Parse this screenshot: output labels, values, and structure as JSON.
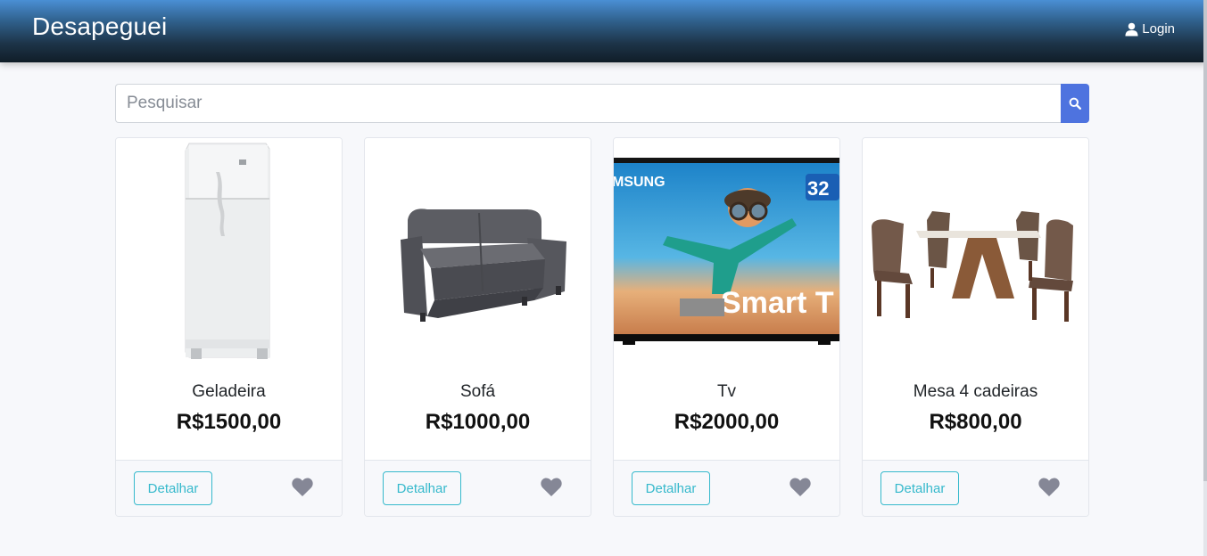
{
  "navbar": {
    "brand": "Desapeguei",
    "login_label": "Login"
  },
  "search": {
    "placeholder": "Pesquisar",
    "value": ""
  },
  "products": [
    {
      "name": "Geladeira",
      "price": "R$1500,00",
      "detail_label": "Detalhar",
      "image": "refrigerator"
    },
    {
      "name": "Sofá",
      "price": "R$1000,00",
      "detail_label": "Detalhar",
      "image": "sofa"
    },
    {
      "name": "Tv",
      "price": "R$2000,00",
      "detail_label": "Detalhar",
      "image": "tv",
      "image_text": {
        "brand": "MSUNG",
        "size": "32",
        "model": "Smart T"
      }
    },
    {
      "name": "Mesa 4 cadeiras",
      "price": "R$800,00",
      "detail_label": "Detalhar",
      "image": "dining-table"
    }
  ],
  "colors": {
    "accent": "#4e73df",
    "info": "#36b9cc",
    "heart": "#858796"
  }
}
